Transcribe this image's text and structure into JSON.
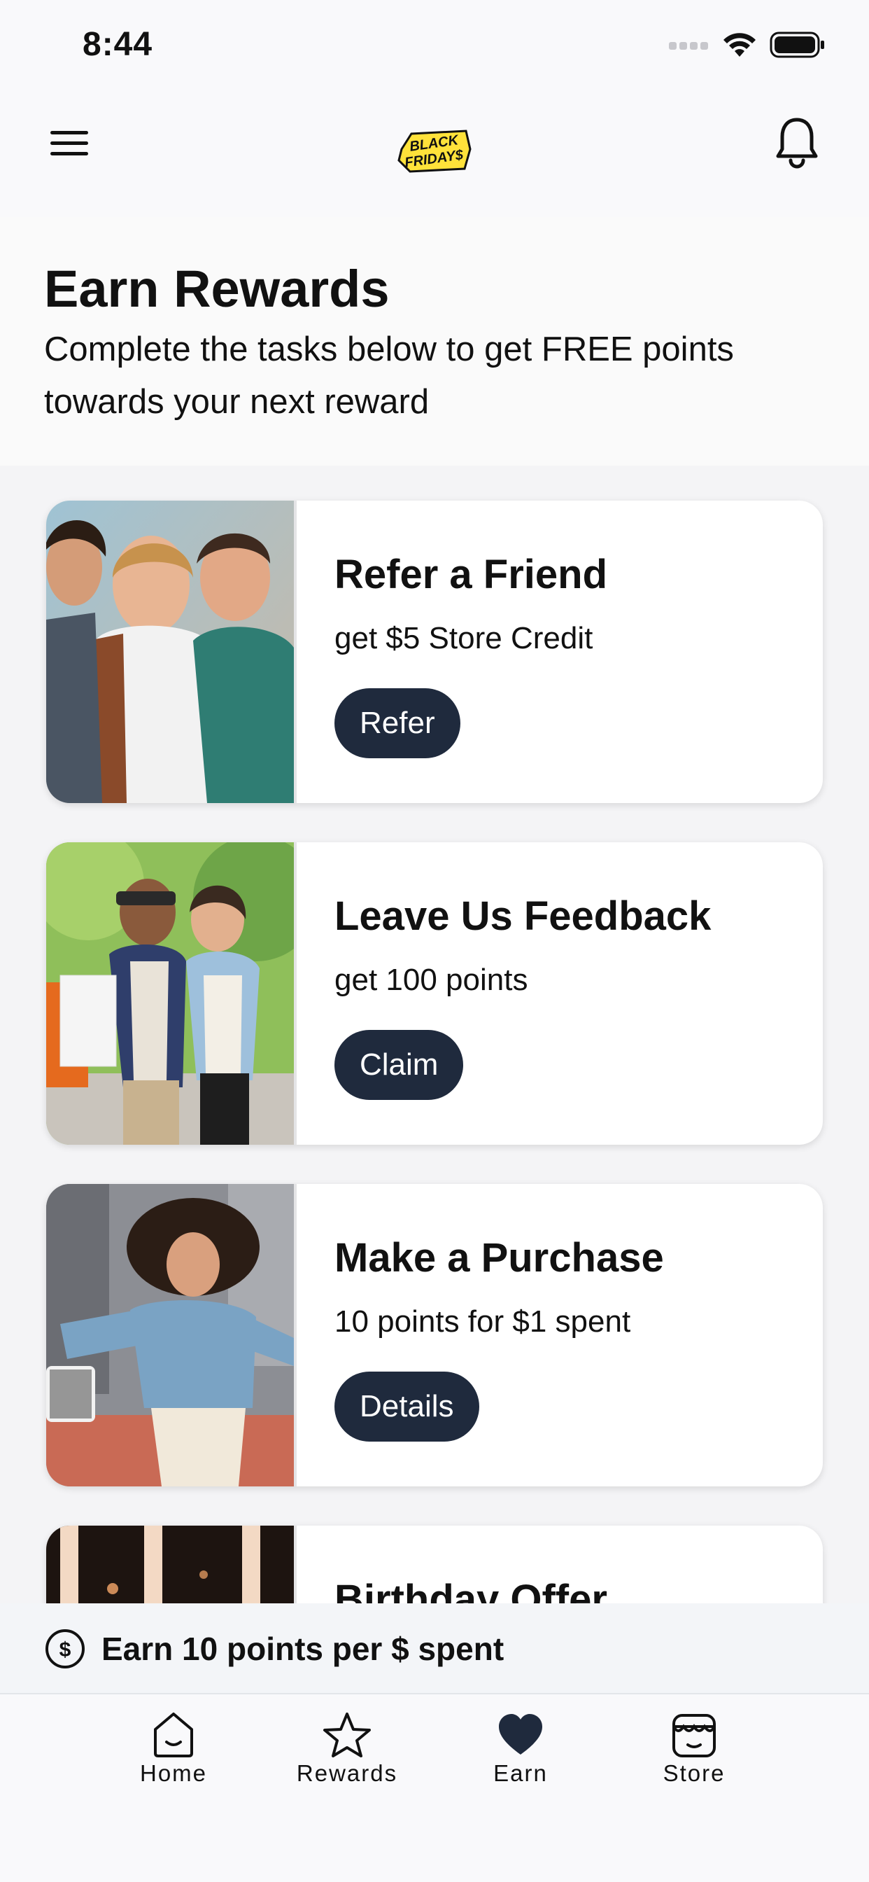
{
  "status_bar": {
    "time": "8:44"
  },
  "header": {
    "logo_text_line1": "BLACK",
    "logo_text_line2": "FRIDAY$"
  },
  "hero": {
    "title": "Earn Rewards",
    "subtitle": "Complete the tasks below to get FREE points towards your next reward"
  },
  "cards": [
    {
      "title": "Refer a Friend",
      "description": "get $5 Store Credit",
      "button": "Refer"
    },
    {
      "title": "Leave Us Feedback",
      "description": "get 100 points",
      "button": "Claim"
    },
    {
      "title": "Make a Purchase",
      "description": "10 points for $1 spent",
      "button": "Details"
    },
    {
      "title": "Birthday Offer"
    }
  ],
  "banner": {
    "text": "Earn 10 points per $ spent"
  },
  "tabs": [
    {
      "label": "Home",
      "icon": "home-face-icon"
    },
    {
      "label": "Rewards",
      "icon": "star-icon"
    },
    {
      "label": "Earn",
      "icon": "heart-icon",
      "active": true
    },
    {
      "label": "Store",
      "icon": "store-icon"
    }
  ],
  "colors": {
    "button_bg": "#1f2a3d",
    "logo_yellow": "#ffe23a",
    "background": "#f4f4f6"
  }
}
